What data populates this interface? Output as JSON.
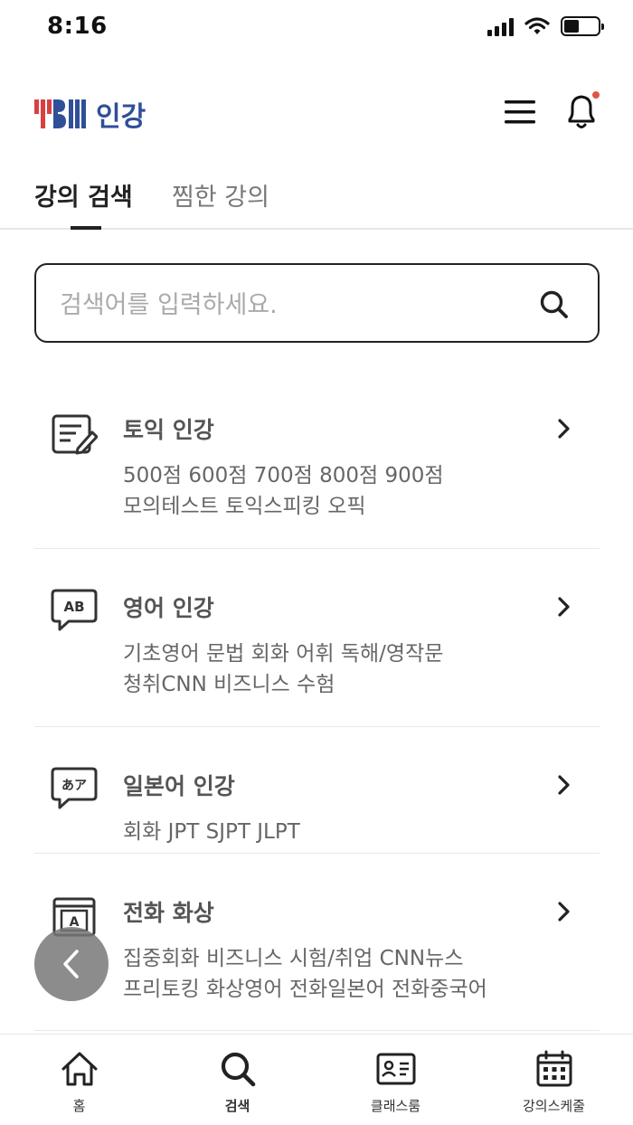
{
  "status_bar": {
    "time": "8:16"
  },
  "header": {
    "logo_text": "인강"
  },
  "tabs": [
    {
      "label": "강의 검색",
      "active": true
    },
    {
      "label": "찜한 강의",
      "active": false
    }
  ],
  "search": {
    "placeholder": "검색어를 입력하세요."
  },
  "categories": [
    {
      "title": "토익 인강",
      "icon": "form-edit-icon",
      "lines": [
        "500점 600점 700점 800점 900점",
        "모의테스트 토익스피킹 오픽"
      ]
    },
    {
      "title": "영어 인강",
      "icon": "ab-chat-icon",
      "lines": [
        "기초영어 문법 회화 어휘 독해/영작문",
        "청취CNN 비즈니스 수험"
      ]
    },
    {
      "title": "일본어 인강",
      "icon": "japanese-chat-icon",
      "lines": [
        "회화 JPT SJPT JLPT"
      ]
    },
    {
      "title": "전화 화상",
      "icon": "video-call-icon",
      "lines": [
        "집중회화 비즈니스 시험/취업 CNN뉴스",
        "프리토킹 화상영어 전화일본어 전화중국어"
      ]
    }
  ],
  "bottom_nav": [
    {
      "label": "홈",
      "icon": "home-icon",
      "active": false
    },
    {
      "label": "검색",
      "icon": "search-icon",
      "active": true
    },
    {
      "label": "클래스룸",
      "icon": "id-card-icon",
      "active": false
    },
    {
      "label": "강의스케줄",
      "icon": "calendar-icon",
      "active": false
    }
  ],
  "colors": {
    "brand_blue": "#2f4f98",
    "brand_red": "#d94040",
    "notification_dot": "#e05545"
  }
}
